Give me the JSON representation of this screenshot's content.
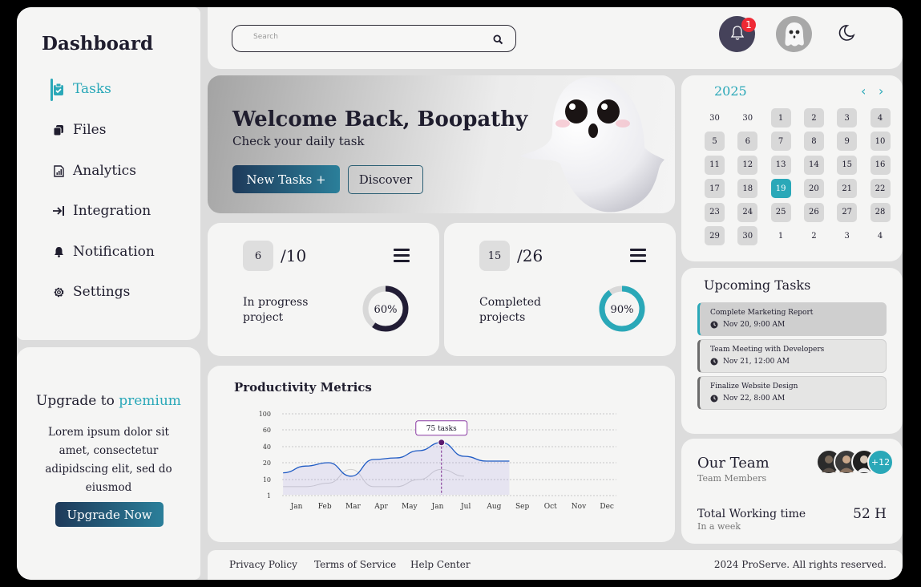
{
  "sidebar": {
    "title": "Dashboard",
    "items": [
      {
        "label": "Tasks",
        "icon": "clipboard-check-icon",
        "active": true
      },
      {
        "label": "Files",
        "icon": "files-icon"
      },
      {
        "label": "Analytics",
        "icon": "analytics-icon"
      },
      {
        "label": "Integration",
        "icon": "arrow-to-line-icon"
      },
      {
        "label": "Notification",
        "icon": "bell-icon"
      },
      {
        "label": "Settings",
        "icon": "gear-icon"
      }
    ]
  },
  "upgrade": {
    "title_prefix": "Upgrade to",
    "title_highlight": "premium",
    "description": "Lorem ipsum dolor sit amet, consectetur adipidscing elit, sed do eiusmod",
    "button": "Upgrade Now"
  },
  "topbar": {
    "search_placeholder": "Search",
    "notification_count": "1"
  },
  "hero": {
    "title": "Welcome Back, Boopathy",
    "subtitle": "Check your daily task",
    "primary_button": "New Tasks +",
    "secondary_button": "Discover"
  },
  "stats": [
    {
      "value": "6",
      "total": "/10",
      "label": "In progress project",
      "percent_label": "60%",
      "percent": 60,
      "color": "#221d35"
    },
    {
      "value": "15",
      "total": "/26",
      "label": "Completed projects",
      "percent_label": "90%",
      "percent": 90,
      "color": "#2aa8b8"
    }
  ],
  "metrics": {
    "title": "Productivity Metrics",
    "tooltip": "75 tasks"
  },
  "chart_data": {
    "type": "area",
    "title": "Productivity Metrics",
    "categories": [
      "Jan",
      "Feb",
      "Mar",
      "Apr",
      "May",
      "Jan",
      "Jul",
      "Aug",
      "Sep",
      "Oct",
      "Nov",
      "Dec"
    ],
    "y_ticks": [
      "100",
      "60",
      "40",
      "20",
      "10",
      "1"
    ],
    "series": [
      {
        "values": [
          14,
          18,
          20,
          12,
          24,
          26,
          35,
          45,
          28,
          22,
          22,
          null
        ],
        "color": "#1f5bc4"
      },
      {
        "values": [
          6,
          6,
          8,
          16,
          6,
          6,
          10,
          16,
          12,
          null,
          null,
          null
        ],
        "color": "#cfcfcf"
      }
    ],
    "highlight": {
      "category": "Aug",
      "label": "75 tasks"
    },
    "grid": true
  },
  "calendar": {
    "year": "2025",
    "days": [
      "30",
      "30",
      "1",
      "2",
      "3",
      "4",
      "5",
      "6",
      "7",
      "8",
      "9",
      "10",
      "11",
      "12",
      "13",
      "14",
      "15",
      "16",
      "17",
      "18",
      "19",
      "20",
      "21",
      "22",
      "23",
      "24",
      "25",
      "26",
      "27",
      "28",
      "29",
      "30",
      "1",
      "2",
      "3",
      "4"
    ],
    "today": "19"
  },
  "upcoming": {
    "title": "Upcoming Tasks",
    "tasks": [
      {
        "title": "Complete Marketing Report",
        "date": "Nov 20, 9:00 AM"
      },
      {
        "title": "Team Meeting with Developers",
        "date": "Nov 21, 12:00 AM"
      },
      {
        "title": "Finalize Website Design",
        "date": "Nov 22, 8:00 AM"
      }
    ]
  },
  "team": {
    "title": "Our Team",
    "subtitle": "Team Members",
    "extra_members": "+12",
    "working_label": "Total Working time",
    "working_sub": "In a week",
    "working_value": "52 H"
  },
  "footer": {
    "links": [
      "Privacy Policy",
      "Terms of Service",
      "Help Center"
    ],
    "copyright": "2024 ProServe. All rights reserved."
  }
}
